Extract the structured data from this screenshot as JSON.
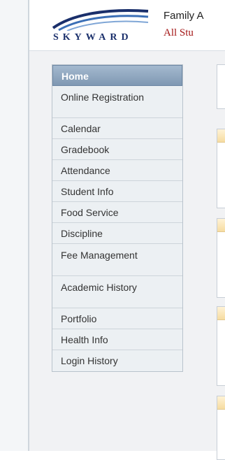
{
  "header": {
    "logo_text": "SKYWARD",
    "title": "Family A",
    "subtitle": "All Stu"
  },
  "sidebar": {
    "items": [
      {
        "label": "Home",
        "active": true
      },
      {
        "label": "Online Registration"
      },
      {
        "label": "Calendar"
      },
      {
        "label": "Gradebook"
      },
      {
        "label": "Attendance"
      },
      {
        "label": "Student Info"
      },
      {
        "label": "Food Service"
      },
      {
        "label": "Discipline"
      },
      {
        "label": "Fee Management"
      },
      {
        "label": "Academic History"
      },
      {
        "label": "Portfolio"
      },
      {
        "label": "Health Info"
      },
      {
        "label": "Login History"
      }
    ]
  },
  "colors": {
    "brand_navy": "#1a2f6b",
    "subtitle_red": "#a31515",
    "active_tab": "#8aa1bb"
  }
}
